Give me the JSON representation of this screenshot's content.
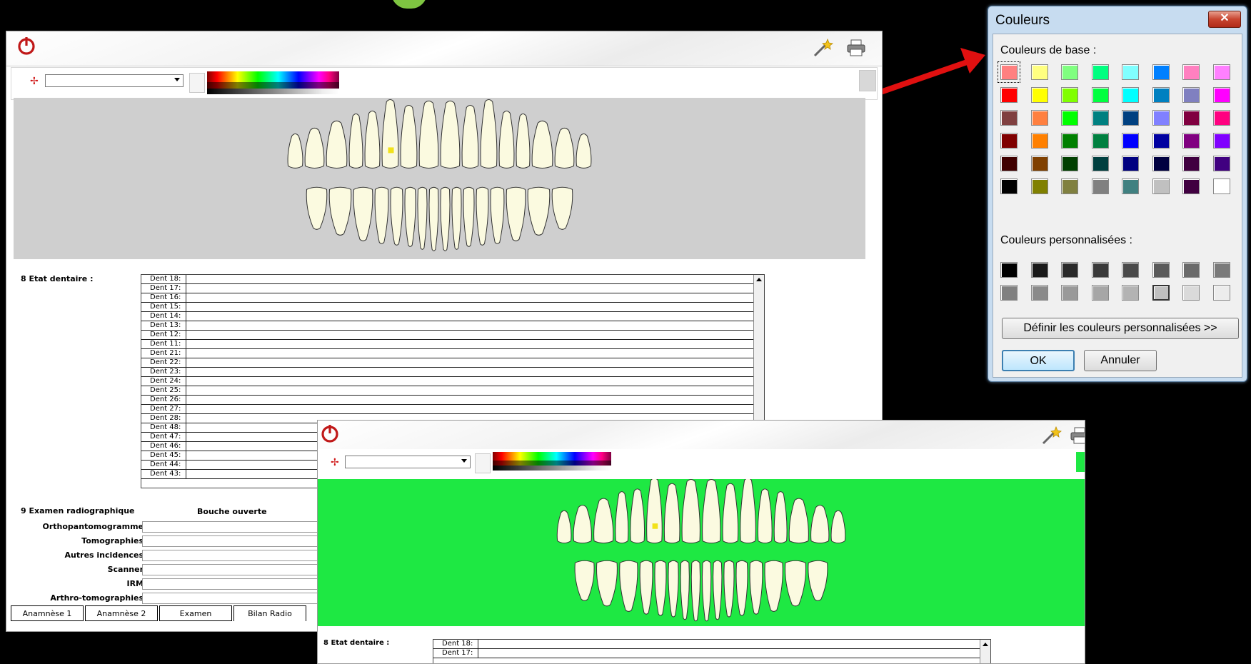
{
  "win1": {
    "section8_label": "8 Etat dentaire :",
    "section9_label": "9 Examen radiographique",
    "col_header": "Bouche ouverte",
    "dents": [
      "Dent 18:",
      "Dent 17:",
      "Dent 16:",
      "Dent 15:",
      "Dent 14:",
      "Dent 13:",
      "Dent 12:",
      "Dent 11:",
      "Dent 21:",
      "Dent 22:",
      "Dent 23:",
      "Dent 24:",
      "Dent 25:",
      "Dent 26:",
      "Dent 27:",
      "Dent 28:",
      "Dent 48:",
      "Dent 47:",
      "Dent 46:",
      "Dent 45:",
      "Dent 44:",
      "Dent 43:"
    ],
    "exam_rows": [
      "Orthopantomogramme",
      "Tomographies",
      "Autres incidences",
      "Scanner",
      "IRM",
      "Arthro-tomographies"
    ],
    "tabs": [
      "Anamnèse 1",
      "Anamnèse 2",
      "Examen",
      "Bilan Radio"
    ],
    "active_tab": "Bilan Radio",
    "chart_bg": "#cfcfcf"
  },
  "win2": {
    "section8_label": "8 Etat dentaire :",
    "dents": [
      "Dent 18:",
      "Dent 17:"
    ],
    "chart_bg": "#1ee843"
  },
  "dialog": {
    "title": "Couleurs",
    "close": "✕",
    "base_label": "Couleurs de base :",
    "custom_label": "Couleurs personnalisées :",
    "define_btn": "Définir les couleurs personnalisées >>",
    "ok": "OK",
    "cancel": "Annuler",
    "base_colors": [
      [
        "#ff8080",
        "#ffff80",
        "#80ff80",
        "#00ff80",
        "#80ffff",
        "#0080ff",
        "#ff80c0",
        "#ff80ff"
      ],
      [
        "#ff0000",
        "#ffff00",
        "#80ff00",
        "#00ff40",
        "#00ffff",
        "#0080c0",
        "#8080c0",
        "#ff00ff"
      ],
      [
        "#804040",
        "#ff8040",
        "#00ff00",
        "#008080",
        "#004080",
        "#8080ff",
        "#800040",
        "#ff0080"
      ],
      [
        "#800000",
        "#ff8000",
        "#008000",
        "#008040",
        "#0000ff",
        "#0000a0",
        "#800080",
        "#8000ff"
      ],
      [
        "#400000",
        "#804000",
        "#004000",
        "#004040",
        "#000080",
        "#000040",
        "#400040",
        "#400080"
      ],
      [
        "#000000",
        "#808000",
        "#808040",
        "#808080",
        "#408080",
        "#c0c0c0",
        "#400040",
        "#ffffff"
      ]
    ],
    "custom_colors": [
      [
        "#000000",
        "#1a1a1a",
        "#2a2a2a",
        "#3a3a3a",
        "#4a4a4a",
        "#5a5a5a",
        "#6a6a6a",
        "#7a7a7a"
      ],
      [
        "#808080",
        "#8a8a8a",
        "#999999",
        "#a6a6a6",
        "#b3b3b3",
        "#c0c0c0",
        "#dadada",
        "#ececec"
      ]
    ]
  }
}
